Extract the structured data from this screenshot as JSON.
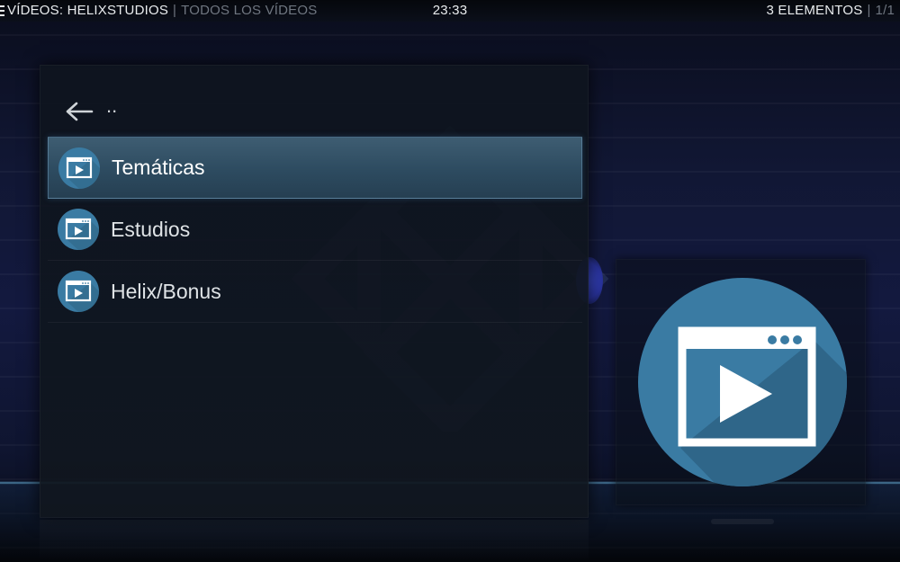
{
  "topbar": {
    "section": "VÍDEOS: HELIXSTUDIOS",
    "separator": "|",
    "subsection": "TODOS LOS VÍDEOS",
    "clock": "23:33",
    "item_count": "3 ELEMENTOS",
    "page_separator": "|",
    "page": "1/1"
  },
  "list": {
    "parent_label": "..",
    "items": [
      {
        "label": "Temáticas",
        "selected": true
      },
      {
        "label": "Estudios",
        "selected": false
      },
      {
        "label": "Helix/Bonus",
        "selected": false
      }
    ]
  },
  "icons": {
    "back": "back-arrow-icon",
    "item": "video-folder-icon",
    "menu": "menu-icon"
  },
  "colors": {
    "accent": "#3a7ba3",
    "selection": "#2f4d62",
    "background": "#12183a"
  }
}
